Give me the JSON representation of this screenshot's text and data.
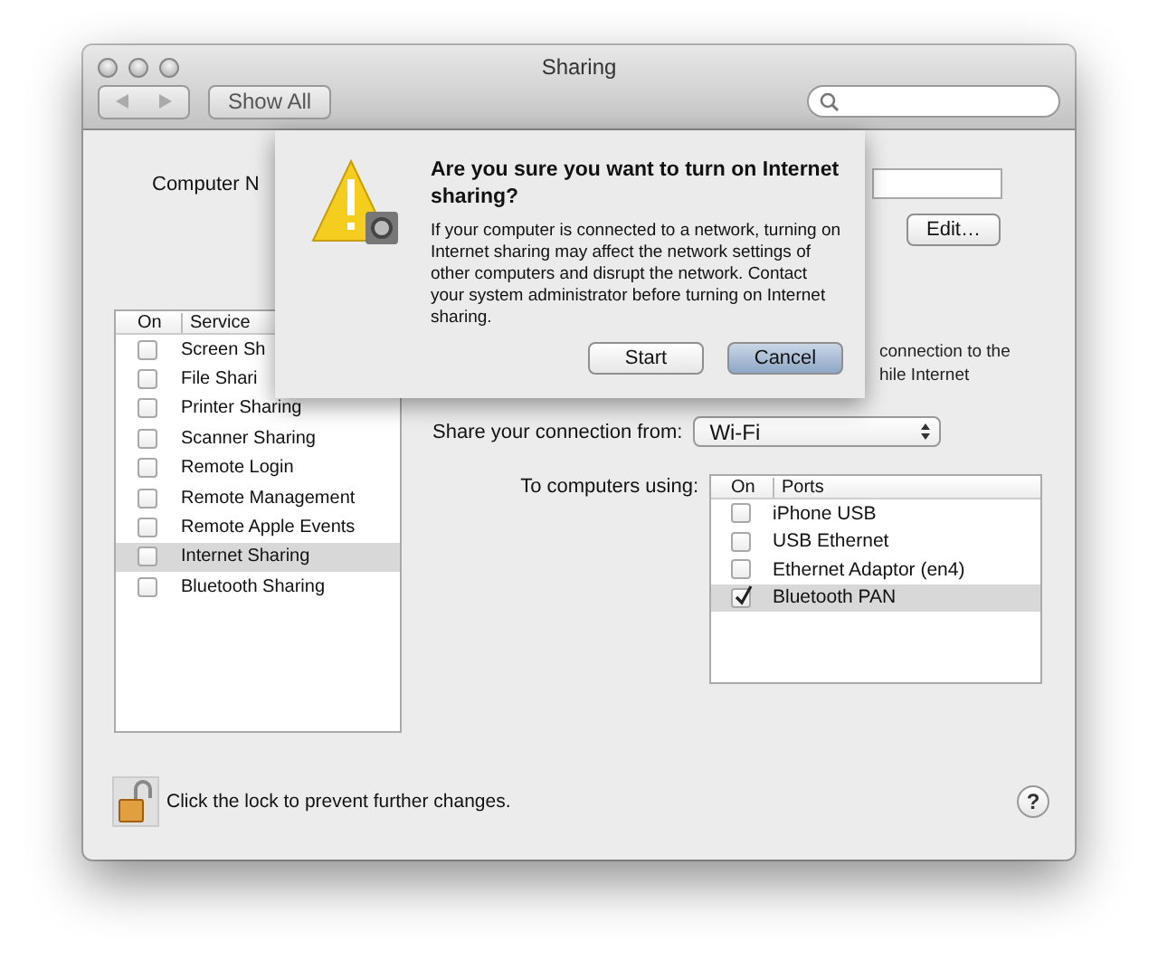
{
  "window": {
    "title": "Sharing"
  },
  "toolbar": {
    "show_all": "Show All"
  },
  "computer_name": {
    "label": "Computer N"
  },
  "edit_button": "Edit…",
  "services": {
    "columns": [
      "On",
      "Service"
    ],
    "rows": [
      {
        "name": "Screen Sh",
        "on": false,
        "selected": false
      },
      {
        "name": "File Shari",
        "on": false,
        "selected": false
      },
      {
        "name": "Printer Sharing",
        "on": false,
        "selected": false
      },
      {
        "name": "Scanner Sharing",
        "on": false,
        "selected": false
      },
      {
        "name": "Remote Login",
        "on": false,
        "selected": false
      },
      {
        "name": "Remote Management",
        "on": false,
        "selected": false
      },
      {
        "name": "Remote Apple Events",
        "on": false,
        "selected": false
      },
      {
        "name": "Internet Sharing",
        "on": false,
        "selected": true
      },
      {
        "name": "Bluetooth Sharing",
        "on": false,
        "selected": false
      }
    ]
  },
  "description_fragments": [
    "connection to the",
    "hile Internet"
  ],
  "share_from": {
    "label": "Share your connection from:",
    "value": "Wi-Fi"
  },
  "ports": {
    "label": "To computers using:",
    "columns": [
      "On",
      "Ports"
    ],
    "rows": [
      {
        "name": "iPhone USB",
        "on": false,
        "selected": false
      },
      {
        "name": "USB Ethernet",
        "on": false,
        "selected": false
      },
      {
        "name": "Ethernet Adaptor (en4)",
        "on": false,
        "selected": false
      },
      {
        "name": "Bluetooth PAN",
        "on": true,
        "selected": true
      }
    ]
  },
  "dialog": {
    "title": "Are you sure you want to turn on Internet sharing?",
    "message": "If your computer is connected to a network, turning on Internet sharing may affect the network settings of other computers and disrupt the network. Contact your system administrator before turning on Internet sharing.",
    "buttons": [
      {
        "label": "Start",
        "default": false
      },
      {
        "label": "Cancel",
        "default": true
      }
    ]
  },
  "footer": {
    "lock_text": "Click the lock to prevent further changes.",
    "help": "?"
  }
}
